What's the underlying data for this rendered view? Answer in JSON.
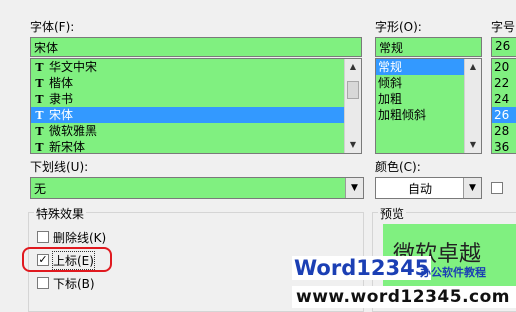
{
  "font_label": "字体(F):",
  "font_value": "宋体",
  "font_list": [
    "华文中宋",
    "楷体",
    "隶书",
    "宋体",
    "微软雅黑",
    "新宋体"
  ],
  "font_list_selected": "宋体",
  "font_icon_glyph": "T",
  "style_label": "字形(O):",
  "style_value": "常规",
  "style_list": [
    "常规",
    "倾斜",
    "加粗",
    "加粗倾斜"
  ],
  "style_list_selected": "常规",
  "size_label": "字号",
  "size_value": "26",
  "size_list": [
    "20",
    "22",
    "24",
    "26",
    "28",
    "36"
  ],
  "size_list_selected": "26",
  "underline_label": "下划线(U):",
  "underline_value": "无",
  "color_label": "颜色(C):",
  "color_value": "自动",
  "effects_label": "特殊效果",
  "effects": [
    {
      "label": "删除线(K)",
      "checked": false
    },
    {
      "label": "上标(E)",
      "checked": true
    },
    {
      "label": "下标(B)",
      "checked": false
    }
  ],
  "preview_label": "预览",
  "preview_text": "微软卓越",
  "watermark_brand": "Word12345",
  "watermark_tagline": "办公软件教程",
  "watermark_url": "www.word12345.com",
  "colors": {
    "field_green": "#80f080",
    "selection_blue": "#3399ff",
    "highlight_red": "#e0191f",
    "watermark_blue": "#1b3fb4",
    "watermark_orange": "#f08a00"
  },
  "icons": {
    "font_type": "truetype-font-icon",
    "dropdown": "chevron-down-icon",
    "checkmark": "checkmark-icon"
  }
}
